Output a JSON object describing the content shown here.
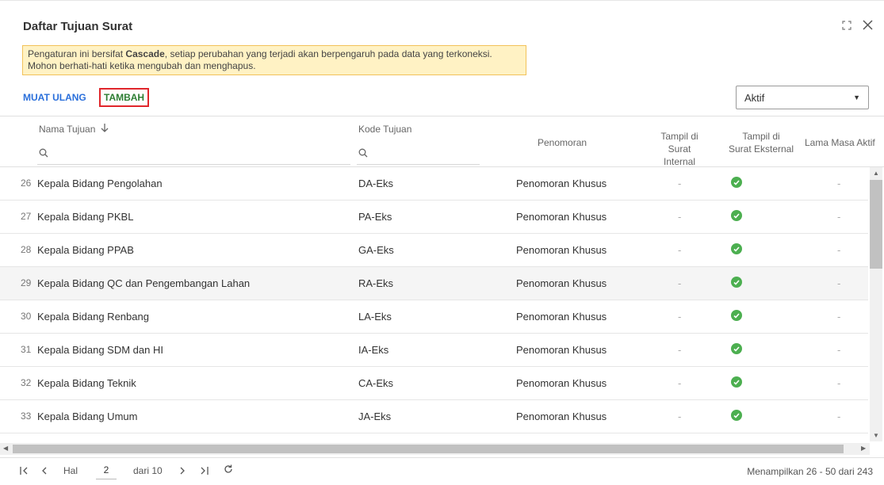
{
  "dialog": {
    "title": "Daftar Tujuan Surat",
    "warning_pre": "Pengaturan ini bersifat ",
    "warning_bold": "Cascade",
    "warning_post": ", setiap perubahan yang terjadi akan berpengaruh pada data yang terkoneksi.",
    "warning_line2": "Mohon berhati-hati ketika mengubah dan menghapus."
  },
  "toolbar": {
    "reload_label": "MUAT ULANG",
    "add_label": "TAMBAH",
    "status_select": "Aktif"
  },
  "columns": {
    "name": "Nama Tujuan",
    "code": "Kode Tujuan",
    "numbering": "Penomoran",
    "internal_l1": "Tampil di",
    "internal_l2": "Surat Internal",
    "external_l1": "Tampil di",
    "external_l2": "Surat Eksternal",
    "duration": "Lama Masa Aktif"
  },
  "rows": [
    {
      "no": "26",
      "name": "Kepala Bidang Pengolahan",
      "code": "DA-Eks",
      "numbering": "Penomoran Khusus",
      "internal": "-",
      "duration": "-"
    },
    {
      "no": "27",
      "name": "Kepala Bidang PKBL",
      "code": "PA-Eks",
      "numbering": "Penomoran Khusus",
      "internal": "-",
      "duration": "-"
    },
    {
      "no": "28",
      "name": "Kepala Bidang PPAB",
      "code": "GA-Eks",
      "numbering": "Penomoran Khusus",
      "internal": "-",
      "duration": "-"
    },
    {
      "no": "29",
      "name": "Kepala Bidang QC dan Pengembangan Lahan",
      "code": "RA-Eks",
      "numbering": "Penomoran Khusus",
      "internal": "-",
      "duration": "-"
    },
    {
      "no": "30",
      "name": "Kepala Bidang Renbang",
      "code": "LA-Eks",
      "numbering": "Penomoran Khusus",
      "internal": "-",
      "duration": "-"
    },
    {
      "no": "31",
      "name": "Kepala Bidang SDM dan HI",
      "code": "IA-Eks",
      "numbering": "Penomoran Khusus",
      "internal": "-",
      "duration": "-"
    },
    {
      "no": "32",
      "name": "Kepala Bidang Teknik",
      "code": "CA-Eks",
      "numbering": "Penomoran Khusus",
      "internal": "-",
      "duration": "-"
    },
    {
      "no": "33",
      "name": "Kepala Bidang Umum",
      "code": "JA-Eks",
      "numbering": "Penomoran Khusus",
      "internal": "-",
      "duration": "-"
    }
  ],
  "pagination": {
    "hal_label": "Hal",
    "current_page": "2",
    "of_label": "dari 10",
    "summary": "Menampilkan 26 - 50 dari 243"
  },
  "colors": {
    "accent": "#2a6fdb",
    "add": "#2e7d32",
    "highlight": "#e0262b",
    "check": "#4caf50",
    "warning_bg": "#fff2c4"
  }
}
